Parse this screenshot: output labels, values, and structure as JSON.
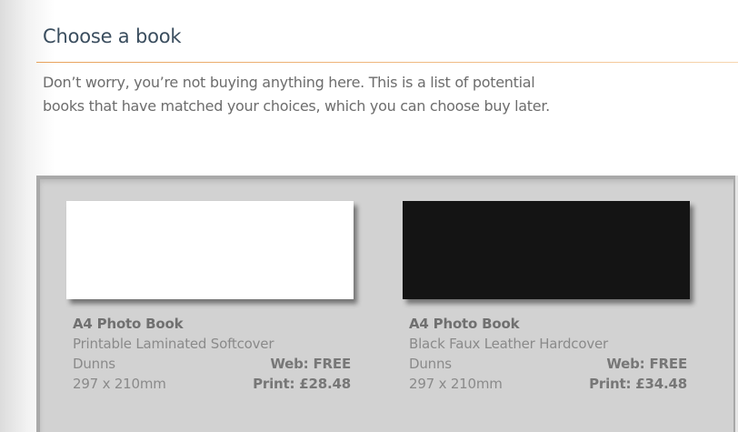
{
  "header": {
    "title": "Choose a book",
    "intro_line1": "Don’t worry, you’re not buying anything here. This is a list of potential",
    "intro_line2": "books that have matched your choices, which you can choose buy later."
  },
  "books": [
    {
      "title": "A4 Photo Book",
      "cover_type": "Printable Laminated Softcover",
      "supplier": "Dunns",
      "web_price": "Web: FREE",
      "size": "297 x 210mm",
      "print_price": "Print: £28.48",
      "cover_color": "#ffffff"
    },
    {
      "title": "A4 Photo Book",
      "cover_type": "Black Faux Leather Hardcover",
      "supplier": "Dunns",
      "web_price": "Web: FREE",
      "size": "297 x 210mm",
      "print_price": "Print: £34.48",
      "cover_color": "#141414"
    }
  ],
  "colors": {
    "heading": "#3a4d5e",
    "accent_rule": "#e7a25c",
    "panel_bg": "#d2d2d2"
  }
}
